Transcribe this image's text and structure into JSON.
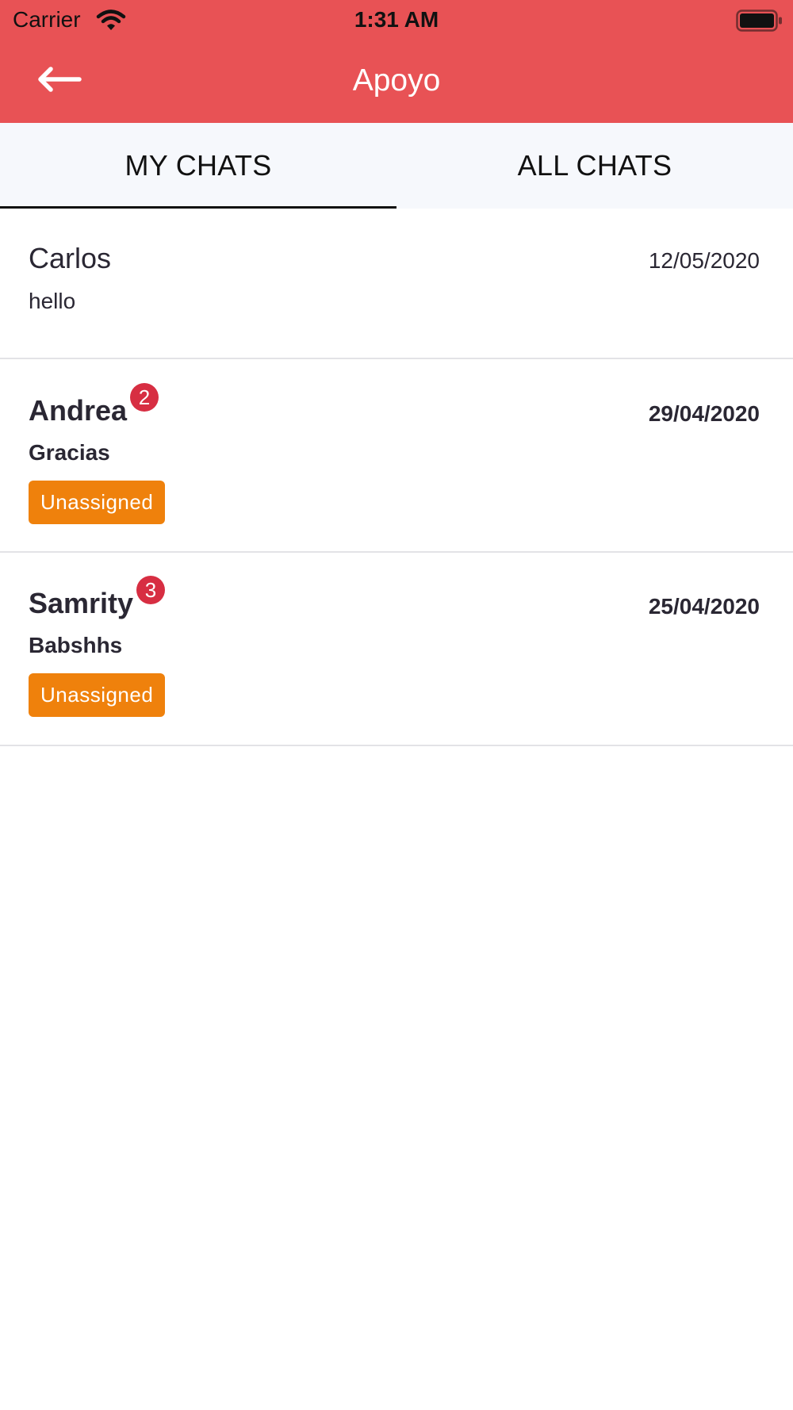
{
  "colors": {
    "header_background": "#e85255",
    "tabs_background": "#f6f8fc",
    "unread_badge": "#d72e42",
    "status_tag": "#ef810c",
    "divider": "#e3e3e6"
  },
  "status_bar": {
    "carrier": "Carrier",
    "time": "1:31 AM",
    "icons": [
      "wifi-icon",
      "battery-icon"
    ]
  },
  "navbar": {
    "back_icon": "arrow-left-icon",
    "title": "Apoyo"
  },
  "tabs": [
    {
      "label": "MY CHATS",
      "selected": true
    },
    {
      "label": "ALL CHATS",
      "selected": false
    }
  ],
  "chats": [
    {
      "name": "Carlos",
      "date": "12/05/2020",
      "preview": "hello"
    },
    {
      "name": "Andrea",
      "date": "29/04/2020",
      "preview": "Gracias",
      "unread_count": "2",
      "status": "Unassigned"
    },
    {
      "name": "Samrity",
      "date": "25/04/2020",
      "preview": "Babshhs",
      "unread_count": "3",
      "status": "Unassigned"
    }
  ]
}
